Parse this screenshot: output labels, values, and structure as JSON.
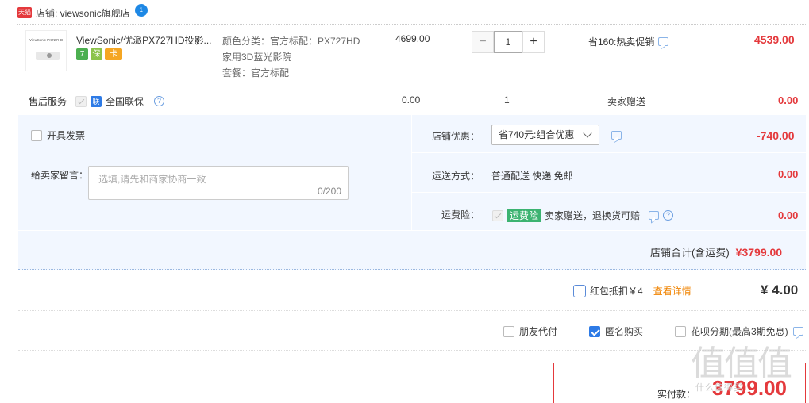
{
  "store": {
    "badge": "天猫",
    "name": "店铺: viewsonic旗舰店",
    "ww_badge": "1"
  },
  "product": {
    "thumb_brand": "ViewSonic PX727HD",
    "title": "ViewSonic/优派PX727HD投影...",
    "badges": [
      "7",
      "保",
      "卡"
    ],
    "sku_lines": [
      "颜色分类：官方标配：PX727HD",
      "家用3D蓝光影院",
      "套餐：官方标配"
    ],
    "unit_price": "4699.00",
    "quantity": "1",
    "minus": "−",
    "plus": "+",
    "promo": "省160:热卖促销",
    "total": "4539.00"
  },
  "service": {
    "label": "售后服务",
    "lian": "联",
    "name": "全国联保",
    "price": "0.00",
    "qty": "1",
    "gift": "卖家赠送",
    "total": "0.00"
  },
  "invoice": {
    "label": "开具发票"
  },
  "message": {
    "label": "给卖家留言：",
    "placeholder": "选填,请先和商家协商一致",
    "count": "0/200"
  },
  "discount": {
    "label": "店铺优惠：",
    "selected": "省740元:组合优惠",
    "amount": "-740.00"
  },
  "shipping": {
    "label": "运送方式：",
    "value": "普通配送 快递 免邮",
    "amount": "0.00"
  },
  "insurance": {
    "label": "运费险：",
    "tag": "运费险",
    "desc": "卖家赠送，退换货可赔",
    "amount": "0.00"
  },
  "store_total": {
    "label": "店铺合计(含运费)",
    "amount": "¥3799.00"
  },
  "redpacket": {
    "label": "红包抵扣￥4",
    "link": "查看详情",
    "amount": "¥ 4.00"
  },
  "options": {
    "friend_pay": "朋友代付",
    "anonymous": "匿名购买",
    "huabei": "花呗分期(最高3期免息)"
  },
  "pay": {
    "label": "实付款：",
    "amount": "3799.00"
  },
  "watermark": {
    "big": "值值值",
    "small": "什么值得买"
  }
}
